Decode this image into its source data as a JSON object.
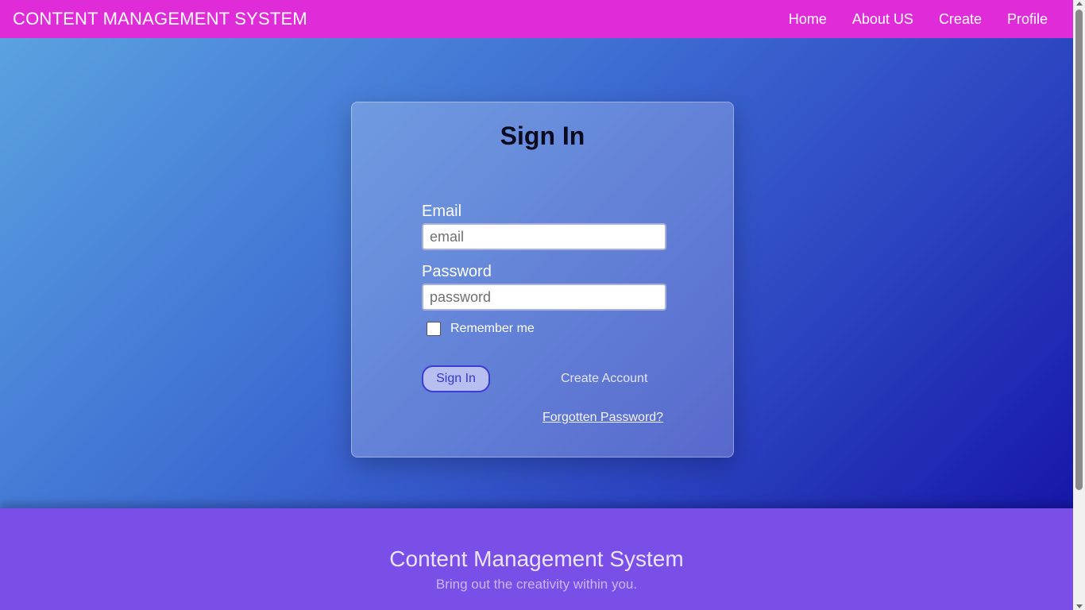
{
  "navbar": {
    "brand": "CONTENT MANAGEMENT SYSTEM",
    "links": [
      "Home",
      "About US",
      "Create",
      "Profile"
    ]
  },
  "signin": {
    "title": "Sign In",
    "email_label": "Email",
    "email_placeholder": "email",
    "password_label": "Password",
    "password_placeholder": "password",
    "remember_label": "Remember me",
    "signin_button": "Sign In",
    "create_account": "Create Account",
    "forgot_password": "Forgotten Password?"
  },
  "footer": {
    "title": "Content Management System",
    "tagline": "Bring out the creativity within you."
  },
  "colors": {
    "navbar": "#e02bd8",
    "footer": "#7a4fe8",
    "gradient_start": "#5aa2e0",
    "gradient_end": "#1717a8"
  }
}
